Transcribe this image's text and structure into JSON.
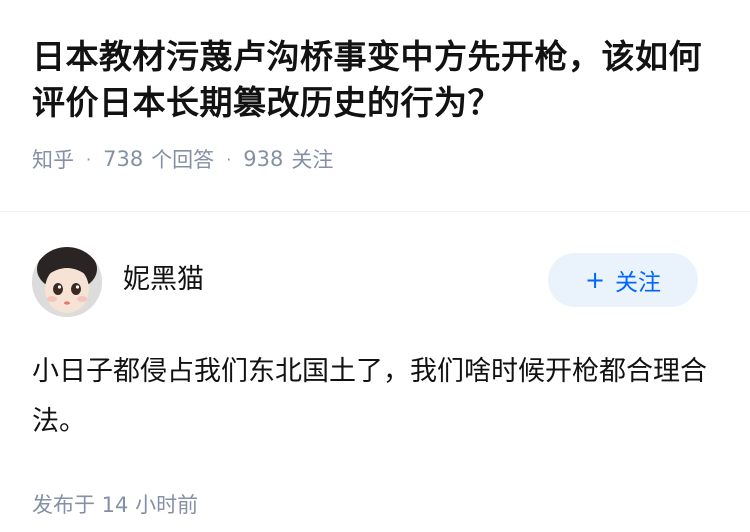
{
  "question": {
    "title": "日本教材污蔑卢沟桥事变中方先开枪，该如何评价日本长期篡改历史的行为？",
    "source": "知乎",
    "answers_count": "738",
    "answers_label": "个回答",
    "followers_count": "938",
    "followers_label": "关注"
  },
  "answer": {
    "author_name": "妮黑猫",
    "follow_button_label": "关注",
    "content": "小日子都侵占我们东北国土了，我们啥时候开枪都合理合法。",
    "publish_time": "发布于  14 小时前"
  },
  "colors": {
    "accent": "#0066ff",
    "follow_bg": "#eaf2fc",
    "meta_text": "#8590a6"
  },
  "icons": {
    "follow": "plus-icon"
  }
}
